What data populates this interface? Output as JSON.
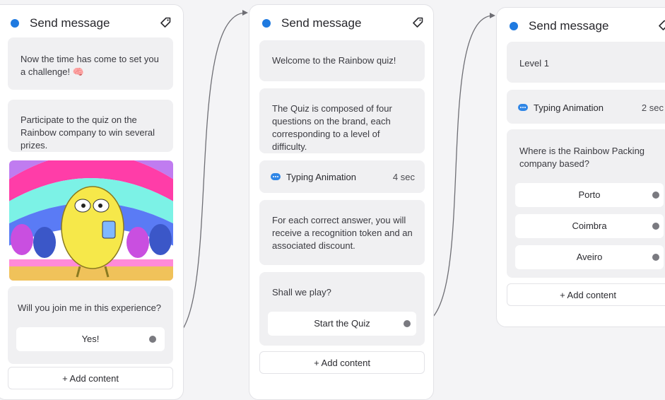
{
  "colors": {
    "accent": "#1f7ae0",
    "card_bg": "#ffffff",
    "block_bg": "#f0f0f2",
    "page_bg": "#f4f4f6",
    "handle": "#7a7a80"
  },
  "icons": {
    "node": "blue-dot-icon",
    "tag": "tag-icon",
    "typing": "typing-bubble-icon",
    "brain": "brain-emoji",
    "handle": "connector-handle-icon"
  },
  "card1": {
    "title": "Send message",
    "text1": "Now the time has come to set you a challenge! 🧠",
    "text2": "Participate to the quiz on the Rainbow company to win several prizes.",
    "question": "Will you join me in this experience?",
    "button": "Yes!",
    "add": "+ Add content"
  },
  "card2": {
    "title": "Send message",
    "welcome": "Welcome to the Rainbow quiz!",
    "composed": "The Quiz is composed of four questions on the brand, each corresponding to a level of difficulty.",
    "typing_label": "Typing Animation",
    "typing_sec": "4 sec",
    "reward": "For each correct answer, you will receive a recognition token and an associated discount.",
    "question": "Shall we play?",
    "button": "Start the Quiz",
    "add": "+ Add content"
  },
  "card3": {
    "title": "Send message",
    "level": "Level 1",
    "typing_label": "Typing Animation",
    "typing_sec": "2 sec",
    "question": "Where is the Rainbow Packing company based?",
    "options": [
      "Porto",
      "Coimbra",
      "Aveiro"
    ],
    "add": "+ Add content"
  }
}
